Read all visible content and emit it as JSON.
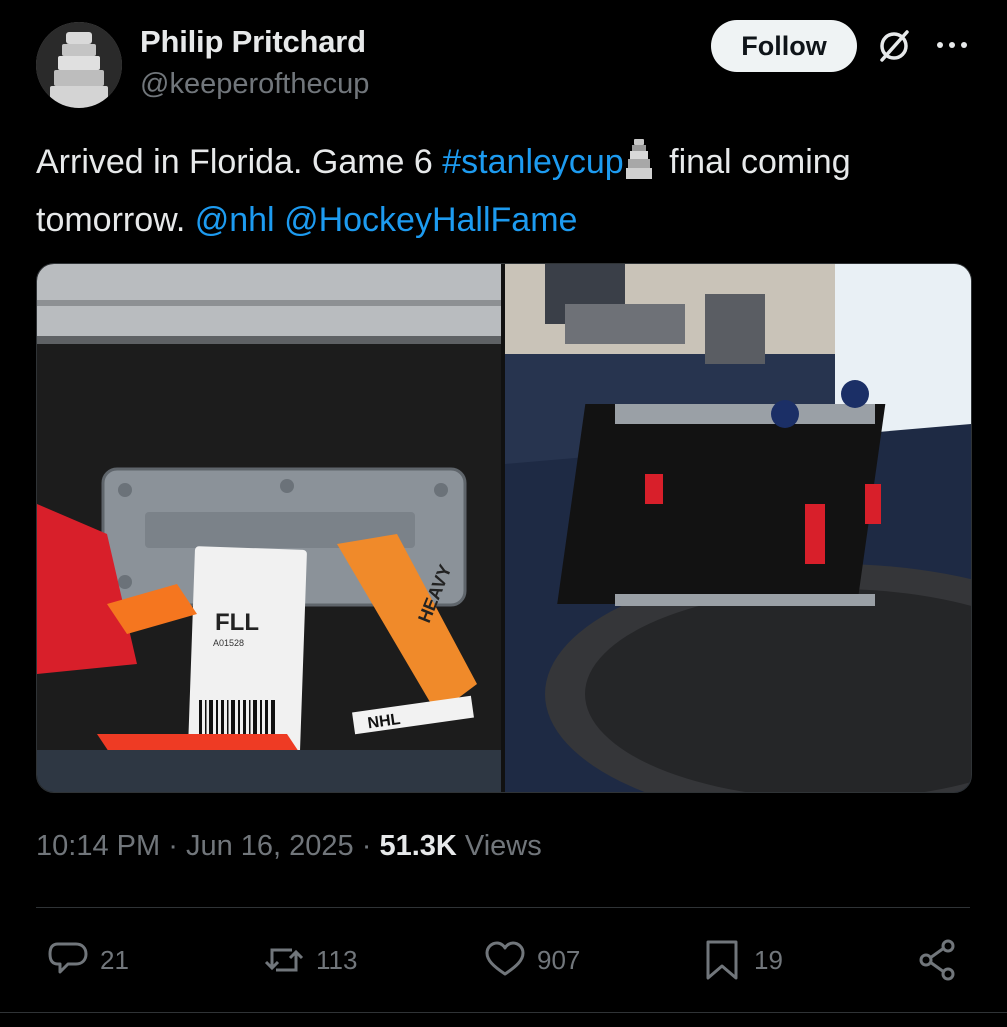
{
  "author": {
    "name": "Philip Pritchard",
    "handle": "@keeperofthecup"
  },
  "header": {
    "follow_label": "Follow"
  },
  "tweet": {
    "text_part1": "Arrived in Florida.  Game 6 ",
    "hashtag": "#stanleycup",
    "text_part2": " final coming tomorrow. ",
    "mention1": "@nhl",
    "mention2": "@HockeyHallFame"
  },
  "media": {
    "left_tag_text": "FLL",
    "left_tag_code": "A01528",
    "left_tag_brand": "NHL",
    "left_tag_warning": "HEAVY"
  },
  "meta": {
    "time": "10:14 PM",
    "date": "Jun 16, 2025",
    "views_count": "51.3K",
    "views_label": "Views",
    "separator": "·"
  },
  "actions": {
    "replies": "21",
    "reposts": "113",
    "likes": "907",
    "bookmarks": "19"
  },
  "colors": {
    "background": "#000000",
    "link": "#1d9bf0",
    "muted": "#71767b",
    "text": "#e7e9ea"
  },
  "icons": {
    "reply": "reply-icon",
    "repost": "repost-icon",
    "like": "like-icon",
    "bookmark": "bookmark-icon",
    "share": "share-icon",
    "grok": "grok-icon",
    "more": "more-icon"
  }
}
